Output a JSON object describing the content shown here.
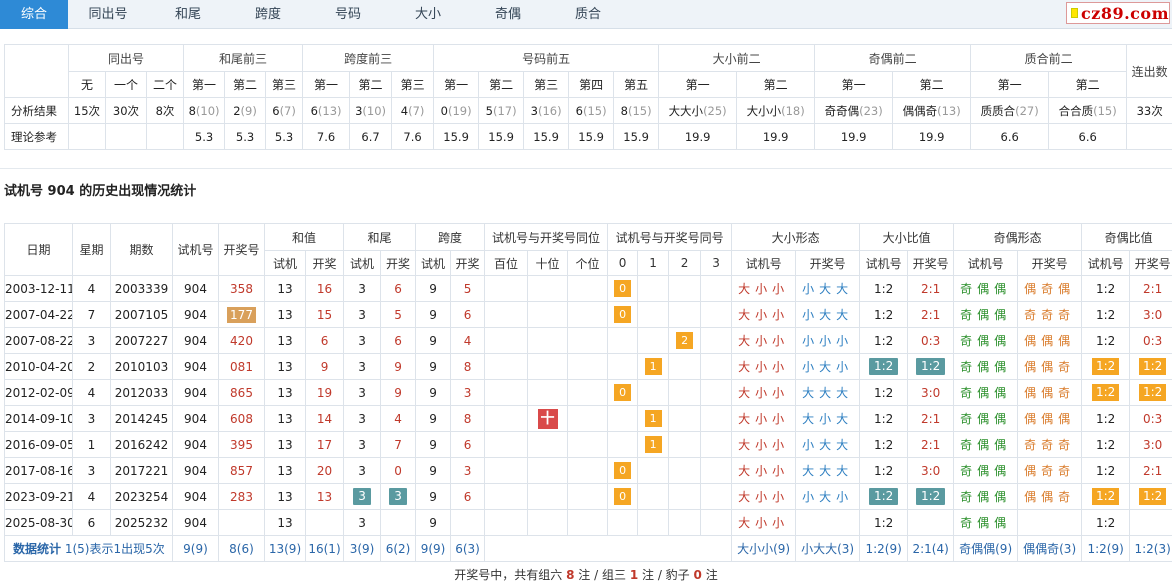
{
  "tabs": [
    "综合",
    "同出号",
    "和尾",
    "跨度",
    "号码",
    "大小",
    "奇偶",
    "质合"
  ],
  "logo": "cz89.com",
  "summary": {
    "groups": [
      "同出号",
      "和尾前三",
      "跨度前三",
      "号码前五",
      "大小前二",
      "奇偶前二",
      "质合前二",
      "连出数"
    ],
    "subs": [
      "无",
      "一个",
      "二个",
      "第一",
      "第二",
      "第三",
      "第一",
      "第二",
      "第三",
      "第一",
      "第二",
      "第三",
      "第四",
      "第五",
      "第一",
      "第二",
      "第一",
      "第二",
      "第一",
      "第二"
    ],
    "row1_label": "分析结果",
    "row1": [
      "15次",
      "30次",
      "8次",
      "8",
      "(10)",
      "2",
      "(9)",
      "6",
      "(7)",
      "6",
      "(13)",
      "3",
      "(10)",
      "4",
      "(7)",
      "0",
      "(19)",
      "5",
      "(17)",
      "3",
      "(16)",
      "6",
      "(15)",
      "8",
      "(15)",
      "大大小",
      "(25)",
      "大小小",
      "(18)",
      "奇奇偶",
      "(23)",
      "偶偶奇",
      "(13)",
      "质质合",
      "(27)",
      "合合质",
      "(15)",
      "33次"
    ],
    "row2_label": "理论参考",
    "row2": [
      "5.3",
      "5.3",
      "5.3",
      "7.6",
      "6.7",
      "7.6",
      "15.9",
      "15.9",
      "15.9",
      "15.9",
      "15.9",
      "19.9",
      "19.9",
      "19.9",
      "19.9",
      "6.6",
      "6.6"
    ]
  },
  "history_title": "试机号 904 的历史出现情况统计",
  "history": {
    "h1": [
      "日期",
      "星期",
      "期数",
      "试机号",
      "开奖号",
      "和值",
      "和尾",
      "跨度",
      "试机号与开奖号同位",
      "试机号与开奖号同号",
      "大小形态",
      "大小比值",
      "奇偶形态",
      "奇偶比值"
    ],
    "h2": [
      "试机",
      "开奖",
      "试机",
      "开奖",
      "试机",
      "开奖",
      "百位",
      "十位",
      "个位",
      "0",
      "1",
      "2",
      "3",
      "试机号",
      "开奖号",
      "试机号",
      "开奖号",
      "试机号",
      "开奖号",
      "试机号",
      "开奖号"
    ],
    "rows": [
      [
        "2003-12-11",
        "4",
        "2003339",
        "904",
        "358",
        "13",
        "16",
        "3",
        "6",
        "9",
        "5",
        "0",
        "大小小",
        "小大大",
        "1:2",
        "2:1",
        "奇偶偶",
        "偶奇偶",
        "1:2",
        "2:1"
      ],
      [
        "2007-04-22",
        "7",
        "2007105",
        "904",
        "177",
        "13",
        "15",
        "3",
        "5",
        "9",
        "6",
        "0",
        "大小小",
        "小大大",
        "1:2",
        "2:1",
        "奇偶偶",
        "奇奇奇",
        "1:2",
        "3:0"
      ],
      [
        "2007-08-22",
        "3",
        "2007227",
        "904",
        "420",
        "13",
        "6",
        "3",
        "6",
        "9",
        "4",
        "2",
        "大小小",
        "小小小",
        "1:2",
        "0:3",
        "奇偶偶",
        "偶偶偶",
        "1:2",
        "0:3"
      ],
      [
        "2010-04-20",
        "2",
        "2010103",
        "904",
        "081",
        "13",
        "9",
        "3",
        "9",
        "9",
        "8",
        "1",
        "大小小",
        "小大小",
        "1:2",
        "1:2",
        "奇偶偶",
        "偶偶奇",
        "1:2",
        "1:2"
      ],
      [
        "2012-02-09",
        "4",
        "2012033",
        "904",
        "865",
        "13",
        "19",
        "3",
        "9",
        "9",
        "3",
        "0",
        "大小小",
        "大大大",
        "1:2",
        "3:0",
        "奇偶偶",
        "偶偶奇",
        "1:2",
        "1:2"
      ],
      [
        "2014-09-10",
        "3",
        "2014245",
        "904",
        "608",
        "13",
        "14",
        "3",
        "4",
        "9",
        "8",
        "1",
        "大小小",
        "大小大",
        "1:2",
        "2:1",
        "奇偶偶",
        "偶偶偶",
        "1:2",
        "0:3"
      ],
      [
        "2016-09-05",
        "1",
        "2016242",
        "904",
        "395",
        "13",
        "17",
        "3",
        "7",
        "9",
        "6",
        "1",
        "大小小",
        "小大大",
        "1:2",
        "2:1",
        "奇偶偶",
        "奇奇奇",
        "1:2",
        "3:0"
      ],
      [
        "2017-08-16",
        "3",
        "2017221",
        "904",
        "857",
        "13",
        "20",
        "3",
        "0",
        "9",
        "3",
        "0",
        "大小小",
        "大大大",
        "1:2",
        "3:0",
        "奇偶偶",
        "偶奇奇",
        "1:2",
        "2:1"
      ],
      [
        "2023-09-21",
        "4",
        "2023254",
        "904",
        "283",
        "13",
        "13",
        "3",
        "3",
        "9",
        "6",
        "0",
        "大小小",
        "小大小",
        "1:2",
        "1:2",
        "奇偶偶",
        "偶偶奇",
        "1:2",
        "1:2"
      ],
      [
        "2025-08-30",
        "6",
        "2025232",
        "904",
        "",
        "13",
        "",
        "3",
        "",
        "9",
        "",
        "",
        "大小小",
        "",
        "1:2",
        "",
        "奇偶偶",
        "",
        "1:2",
        ""
      ]
    ],
    "stats": [
      "数据统计",
      "1(5)表示1出现5次",
      "9(9)",
      "8(6)",
      "13(9)",
      "16(1)",
      "3(9)",
      "6(2)",
      "9(9)",
      "6(3)",
      "大小小(9)",
      "小大大(3)",
      "1:2(9)",
      "2:1(4)",
      "奇偶偶(9)",
      "偶偶奇(3)",
      "1:2(9)",
      "1:2(3)"
    ],
    "ten_mark": "十"
  },
  "footer": {
    "text1": "开奖号中，共有组六",
    "n1": "8",
    "text2": "注 / 组三",
    "n2": "1",
    "text3": "注 / 豹子",
    "n3": "0",
    "text4": "注"
  }
}
